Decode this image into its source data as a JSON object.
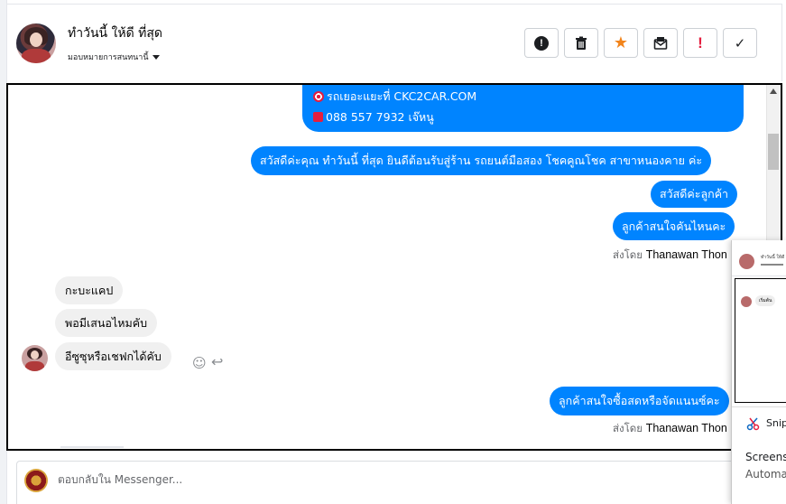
{
  "header": {
    "contact_name": "ทำวันนี้ ให้ดี ที่สุด",
    "assign_label": "มอบหมายการสนทนานี้"
  },
  "actions": [
    {
      "name": "report-icon",
      "label": "!"
    },
    {
      "name": "trash-icon",
      "label": ""
    },
    {
      "name": "star-icon",
      "label": "★"
    },
    {
      "name": "mark-unread-icon",
      "label": ""
    },
    {
      "name": "spam-icon",
      "label": "!"
    },
    {
      "name": "check-icon",
      "label": "✓"
    }
  ],
  "messages": {
    "outgoing_top": {
      "line1": "รถเยอะแยะที่ CKC2CAR.COM",
      "line2": "088 557 7932 เจ๊หนู"
    },
    "outgoing_greeting": "สวัสดีค่ะคุณ ทำวันนี้ ที่สุด ยินดีต้อนรับสู่ร้าน รถยนต์มือสอง โชคคูณโชค สาขาหนองคาย ค่ะ",
    "outgoing_hello": "สวัสดีค่ะลูกค้า",
    "outgoing_ask": "ลูกค้าสนใจคันไหนคะ",
    "sent_by_prefix": "ส่งโดย",
    "sent_by_name": "Thanawan Thon",
    "incoming": [
      "กะบะแคป",
      "พอมีเสนอไหมคับ",
      "อีซูซุหรือเชฟกได้คับ"
    ],
    "outgoing_question": "ลูกค้าสนใจซื้อสดหรือจัดแนนซ์คะ"
  },
  "overlay": {
    "mini_name": "ทำวันนี้ ให้ดี",
    "mini_bubble": "เริ่มต้น",
    "snip_label": "Snip",
    "text1": "Screens",
    "text2": "Automa"
  },
  "composer": {
    "placeholder": "ตอบกลับใน Messenger..."
  }
}
